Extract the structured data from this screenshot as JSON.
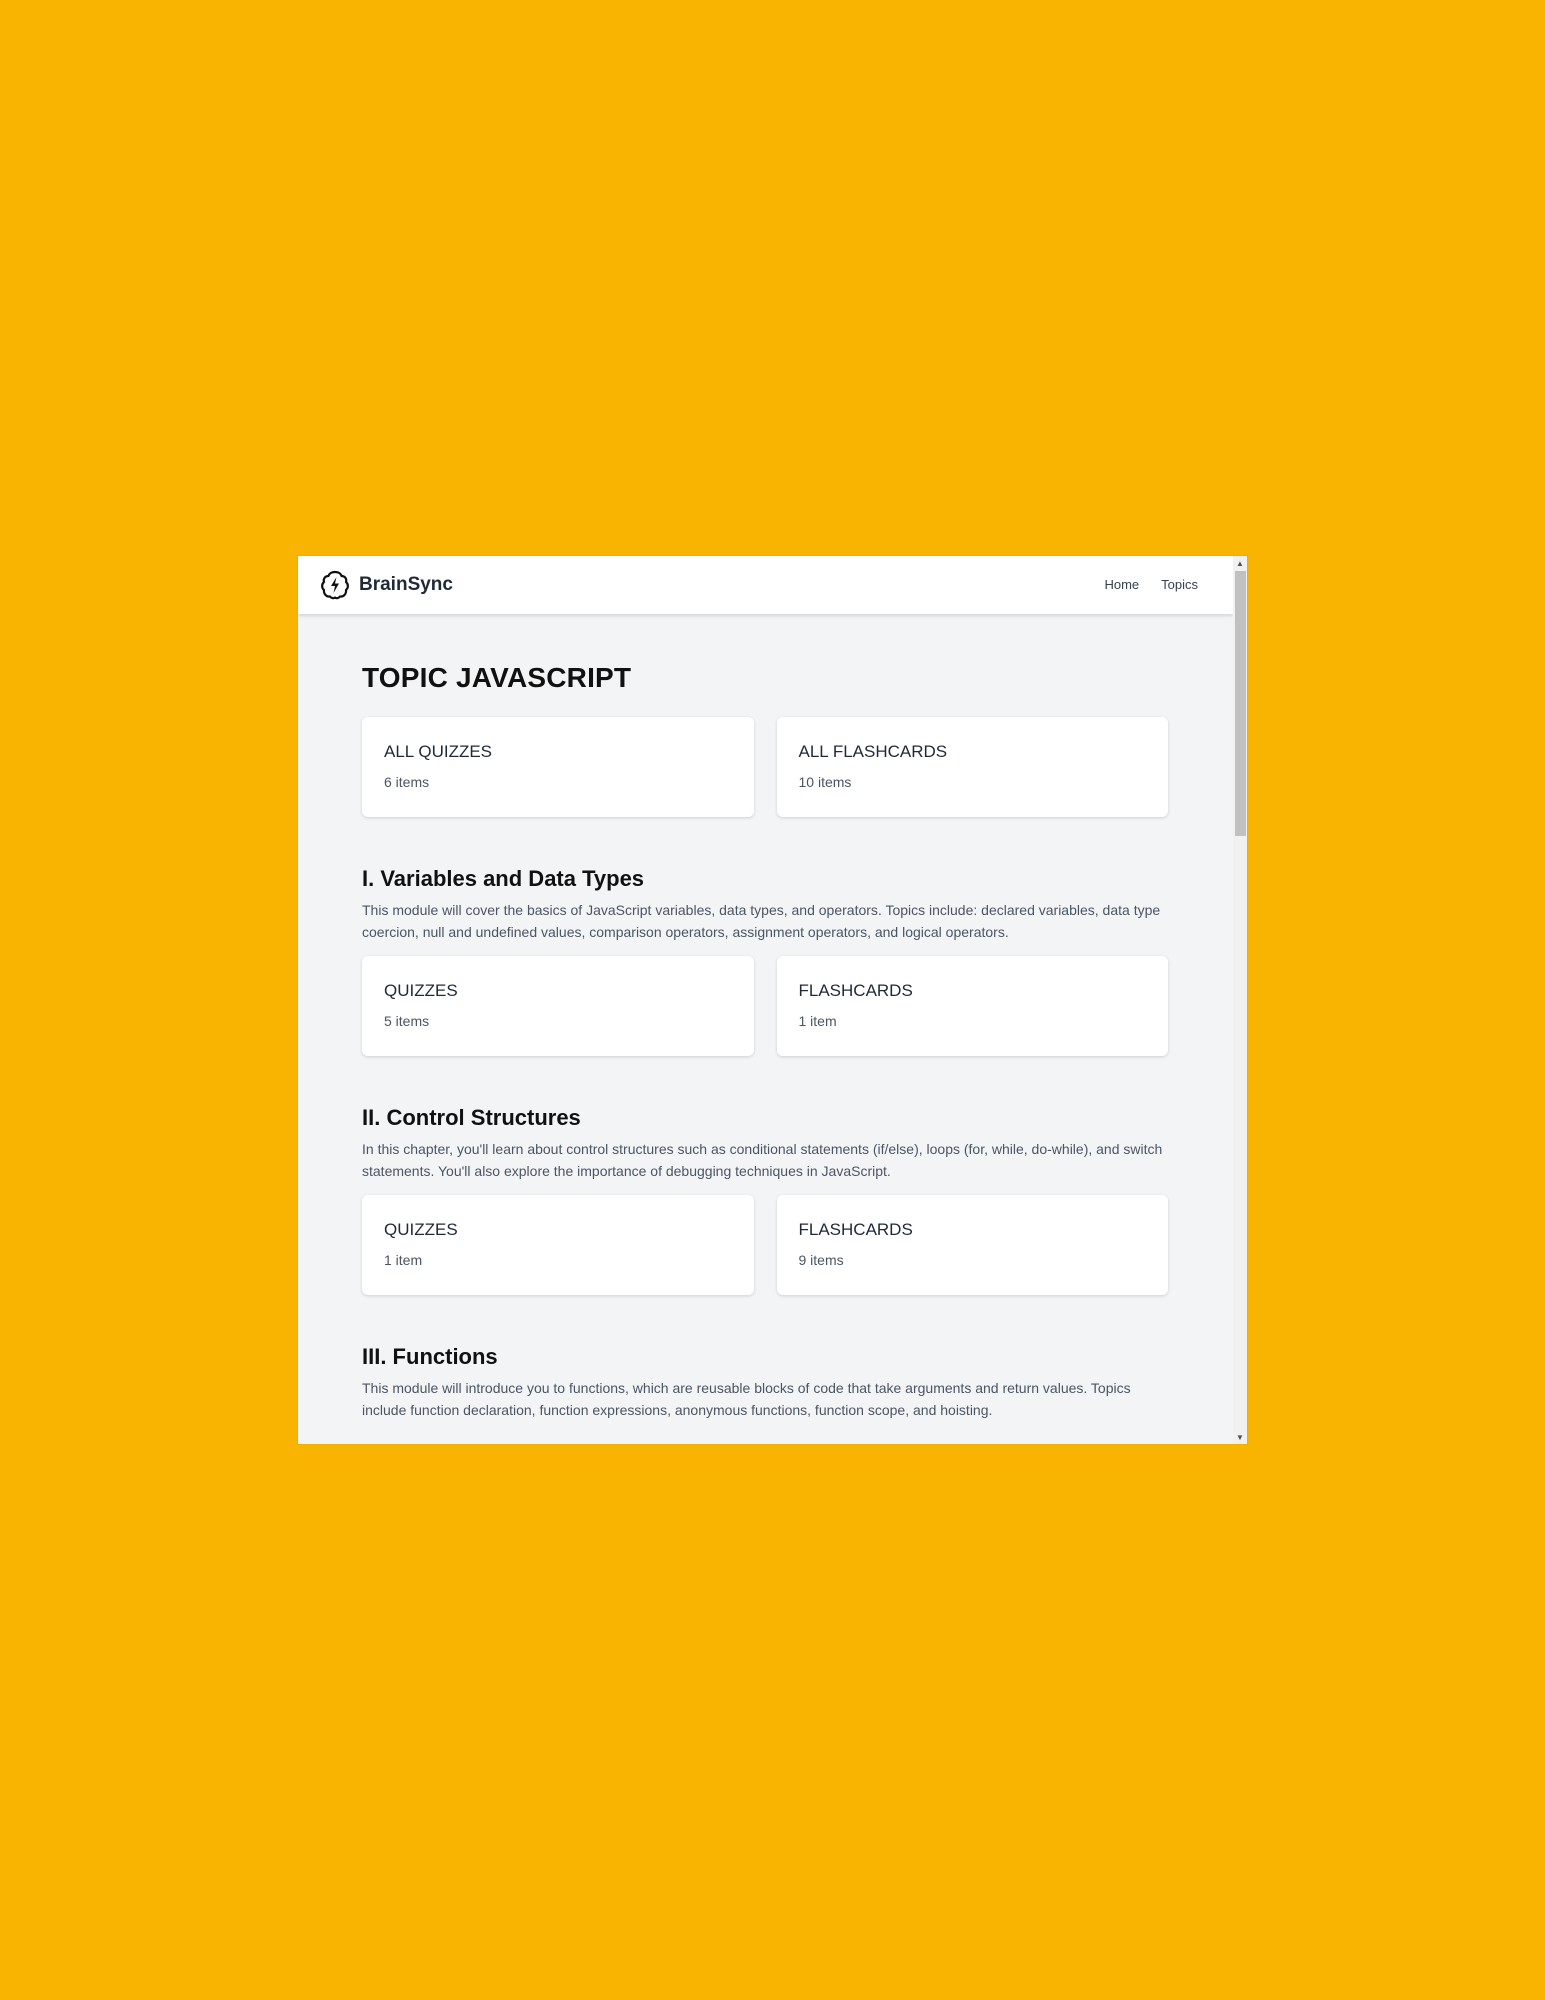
{
  "navbar": {
    "brand": "BrainSync",
    "links": [
      "Home",
      "Topics"
    ]
  },
  "page": {
    "title": "TOPIC JAVASCRIPT",
    "summary_cards": [
      {
        "title": "ALL QUIZZES",
        "count": "6 items"
      },
      {
        "title": "ALL FLASHCARDS",
        "count": "10 items"
      }
    ]
  },
  "sections": [
    {
      "title": "I. Variables and Data Types",
      "description": "This module will cover the basics of JavaScript variables, data types, and operators. Topics include: declared variables, data type coercion, null and undefined values, comparison operators, assignment operators, and logical operators.",
      "cards": [
        {
          "title": "QUIZZES",
          "count": "5 items"
        },
        {
          "title": "FLASHCARDS",
          "count": "1 item"
        }
      ]
    },
    {
      "title": "II. Control Structures",
      "description": "In this chapter, you'll learn about control structures such as conditional statements (if/else), loops (for, while, do-while), and switch statements. You'll also explore the importance of debugging techniques in JavaScript.",
      "cards": [
        {
          "title": "QUIZZES",
          "count": "1 item"
        },
        {
          "title": "FLASHCARDS",
          "count": "9 items"
        }
      ]
    },
    {
      "title": "III. Functions",
      "description": "This module will introduce you to functions, which are reusable blocks of code that take arguments and return values. Topics include function declaration, function expressions, anonymous functions, function scope, and hoisting."
    }
  ],
  "icons": {
    "logo": "brain-lightning-icon",
    "scroll_up": "arrow-up-icon",
    "scroll_down": "arrow-down-icon"
  },
  "colors": {
    "background": "#F8B400",
    "page": "#F3F4F6",
    "card": "#FFFFFF"
  }
}
